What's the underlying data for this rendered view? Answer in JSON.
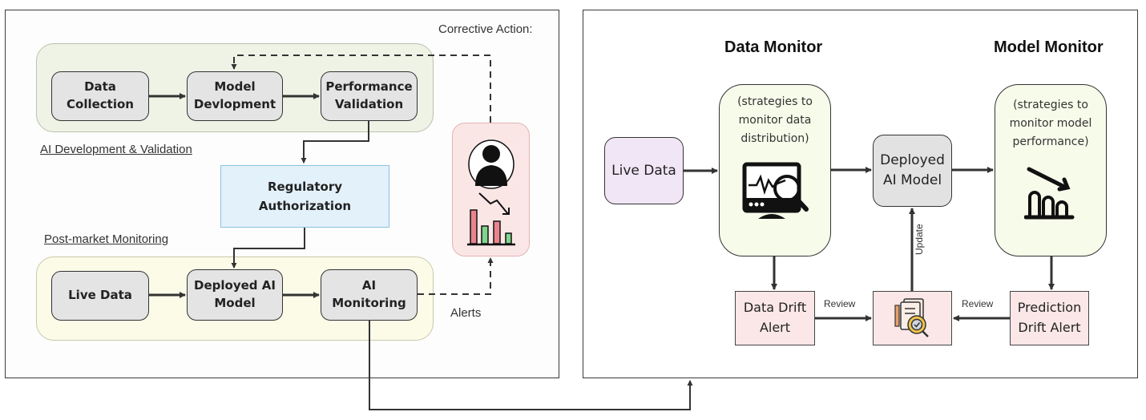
{
  "left_panel": {
    "corrective_action_label": "Corrective Action:",
    "dev_group_label": "AI Development & Validation",
    "post_market_label": "Post-market Monitoring",
    "alerts_label": "Alerts",
    "dev_nodes": [
      {
        "line1": "Data",
        "line2": "Collection"
      },
      {
        "line1": "Model",
        "line2": "Devlopment"
      },
      {
        "line1": "Performance",
        "line2": "Validation"
      }
    ],
    "regulatory": {
      "line1": "Regulatory",
      "line2": "Authorization"
    },
    "pm_nodes": [
      {
        "line1": "Live Data",
        "line2": ""
      },
      {
        "line1": "Deployed AI",
        "line2": "Model"
      },
      {
        "line1": "AI",
        "line2": "Monitoring"
      }
    ],
    "alert_icons": [
      "person-icon",
      "declining-bar-chart-icon"
    ]
  },
  "right_panel": {
    "data_monitor_title": "Data Monitor",
    "model_monitor_title": "Model Monitor",
    "live_data": "Live Data",
    "data_monitor_desc": [
      "(strategies to",
      "monitor data",
      "distribution)"
    ],
    "model_monitor_desc": [
      "(strategies to",
      "monitor model",
      "performance)"
    ],
    "deployed_model": {
      "line1": "Deployed",
      "line2": "AI Model"
    },
    "data_drift_alert": {
      "line1": "Data Drift",
      "line2": "Alert"
    },
    "prediction_drift_alert": {
      "line1": "Prediction",
      "line2": "Drift Alert"
    },
    "review_left": "Review",
    "review_right": "Review",
    "update_label": "Update",
    "icons": {
      "data_monitor": "monitor-magnifier-icon",
      "model_monitor": "declining-chart-icon",
      "review": "document-gear-check-icon"
    }
  }
}
